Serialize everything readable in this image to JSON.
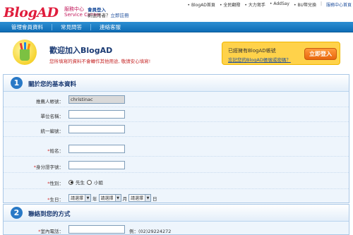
{
  "header": {
    "logo": "BlogAD",
    "service_cn": "服務中心",
    "service_en": "Service Center",
    "member_title": "會員登入",
    "new_user": "新送用者？",
    "register": "立即註冊",
    "topnav": [
      "BlogAD首頁",
      "全民翻撥",
      "大力寫手",
      "AddSay",
      "BU幣兌換"
    ],
    "topnav_center": "服務中心首頁"
  },
  "navbar": [
    "管理會員資料",
    "常見問答",
    "連絡客服"
  ],
  "welcome": {
    "title": "歡迎加入BlogAD",
    "subtitle": "您所填寫的資料不會轉作其他用途, 敬請安心填寫!"
  },
  "loginbox": {
    "line1": "已經擁有BlogAD帳號",
    "line2": "忘記您的BlogAD帳號或密碼？",
    "button": "立即登入"
  },
  "section1": {
    "num": "1",
    "title": "關於您的基本資料",
    "fields": [
      {
        "label": "推薦人帳號：",
        "value": "christinac"
      },
      {
        "label": "單位名稱：",
        "value": ""
      },
      {
        "label": "統一編號：",
        "value": ""
      },
      {
        "label": "姓名：",
        "value": ""
      },
      {
        "label": "身分證字號：",
        "value": ""
      }
    ],
    "gender_label": "性別：",
    "gender_options": [
      "先生",
      "小姐"
    ],
    "birthday_label": "生日：",
    "select_placeholder": "請選擇",
    "year": "年",
    "month": "月",
    "day": "日"
  },
  "section2": {
    "num": "2",
    "title": "聯絡到您的方式",
    "phone_label": "室內電話：",
    "phone_example": "例：(02)29224272"
  }
}
